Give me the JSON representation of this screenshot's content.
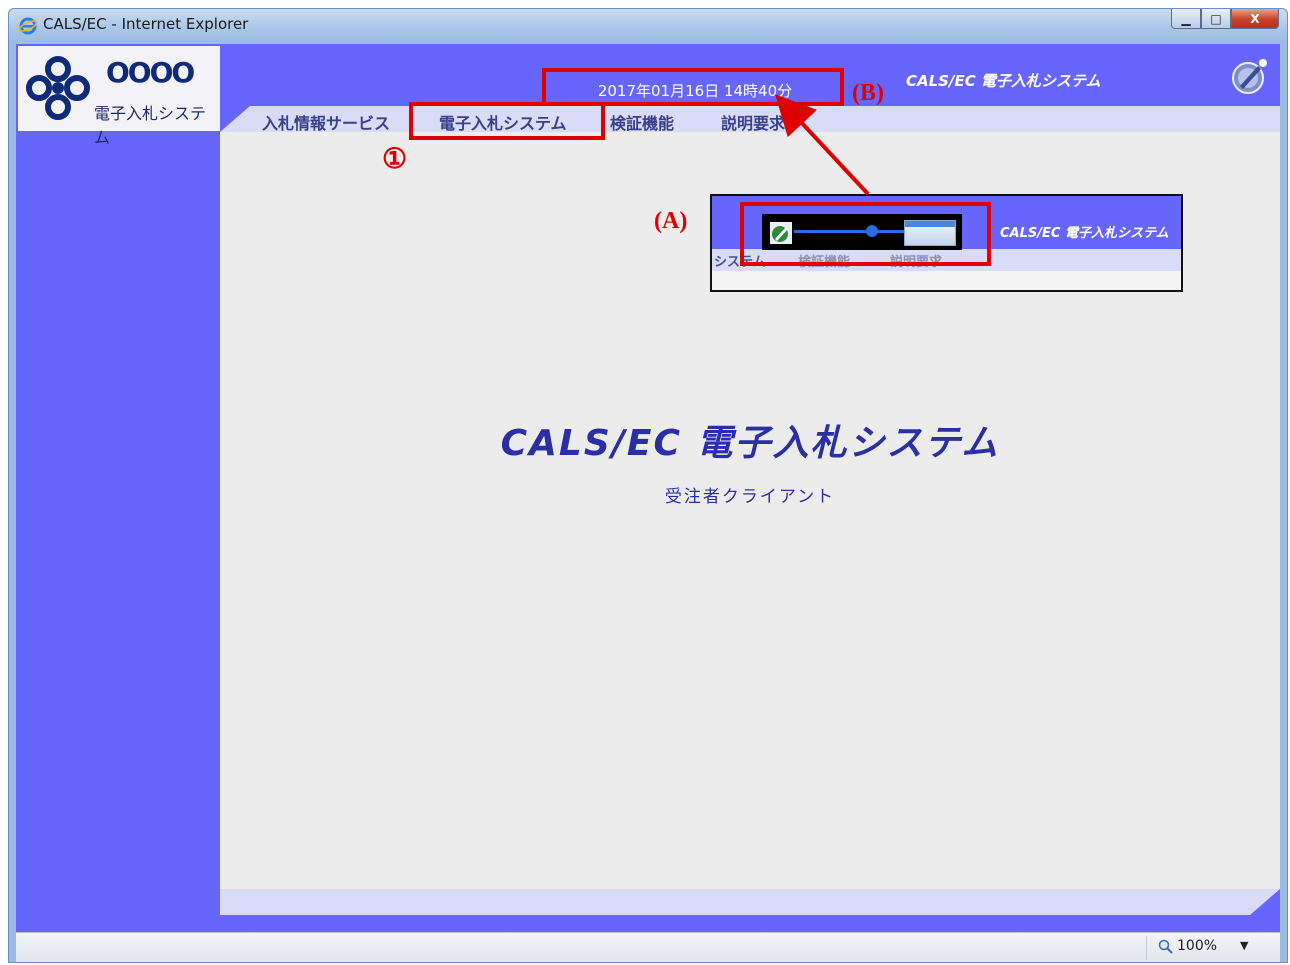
{
  "window": {
    "title": "CALS/EC - Internet Explorer",
    "buttons": {
      "minimize": "▁",
      "maximize": "□",
      "close": "X"
    }
  },
  "logo": {
    "name": "OOOO",
    "subtitle": "電子入札システム"
  },
  "header": {
    "datetime": "2017年01月16日 14時40分",
    "brand": "CALS/EC 電子入札システム"
  },
  "menu": {
    "items": [
      "入札情報サービス",
      "電子入札システム",
      "検証機能",
      "説明要求"
    ]
  },
  "main": {
    "title": "CALS/EC 電子入札システム",
    "subtitle": "受注者クライアント"
  },
  "inset": {
    "brand": "CALS/EC 電子入札システム",
    "menu_items": [
      "システム",
      "検証機能",
      "説明要求"
    ]
  },
  "annotations": {
    "circle1": "①",
    "label_a": "(A)",
    "label_b": "(B)"
  },
  "statusbar": {
    "zoom": "100%"
  },
  "colors": {
    "accent": "#6666ff",
    "menu_bg": "#d8dcf6",
    "highlight": "#e00000",
    "title_text": "#2a2fa5"
  }
}
